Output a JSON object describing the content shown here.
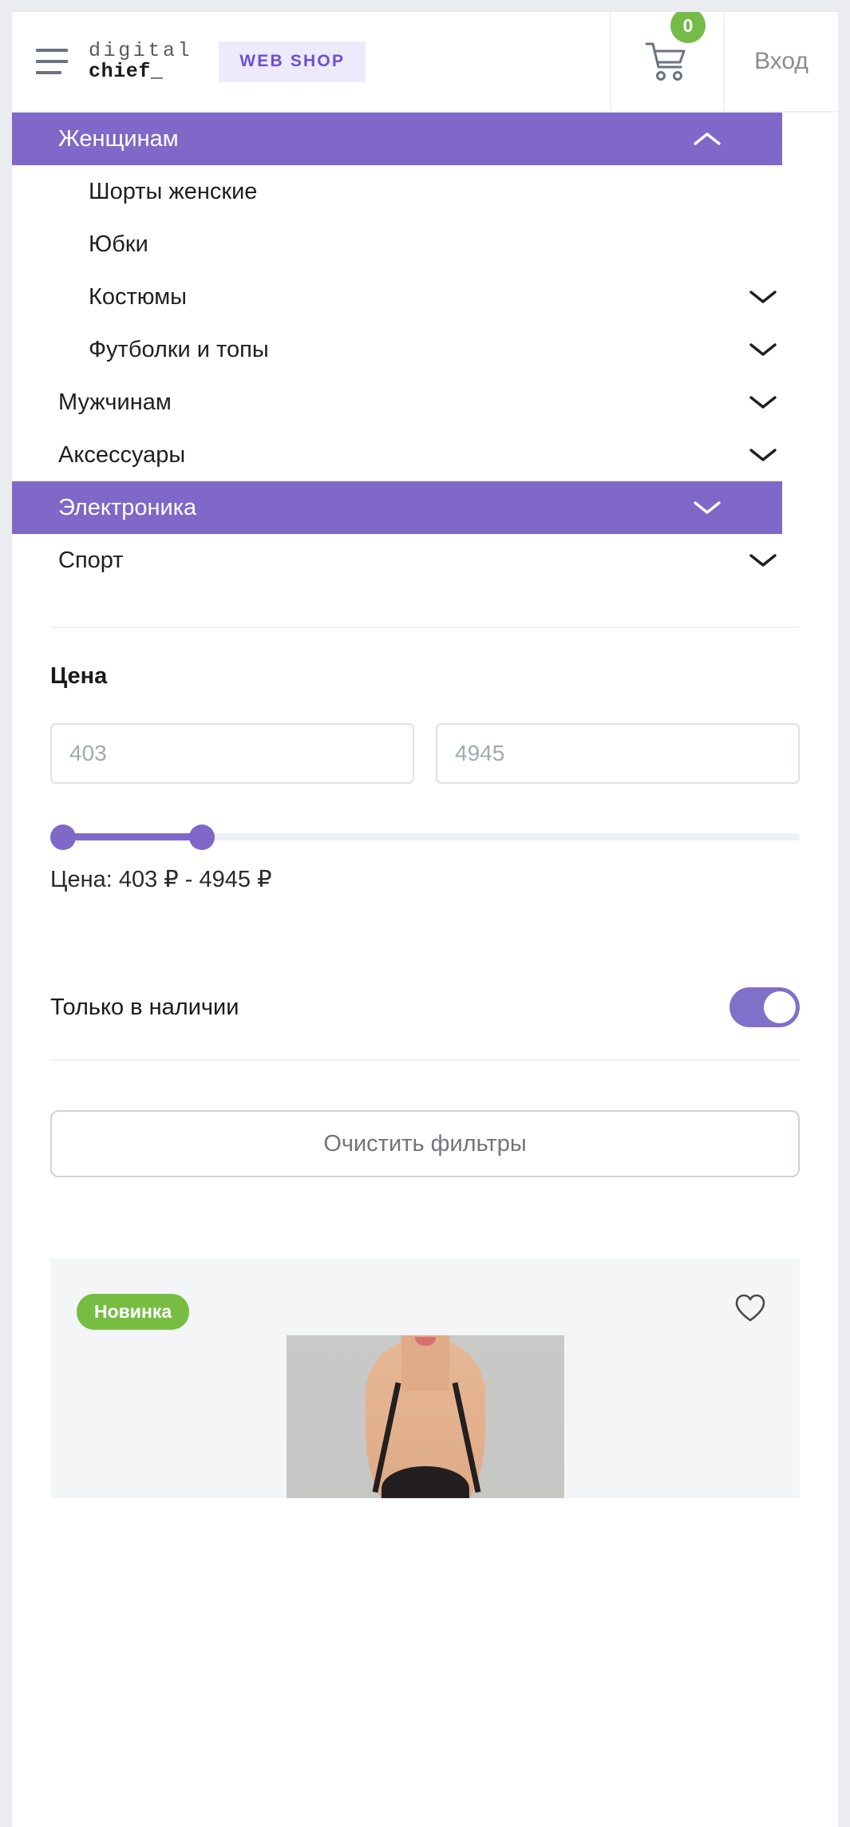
{
  "header": {
    "menu_icon": "hamburger-menu-icon",
    "logo_line1": "digital",
    "logo_line2": "chief_",
    "webshop_label": "WEB SHOP",
    "cart_icon": "shopping-cart-icon",
    "cart_count": "0",
    "login_label": "Вход"
  },
  "categories": [
    {
      "label": "Женщинам",
      "level": 0,
      "active": true,
      "chevron": "up",
      "name": "category-women"
    },
    {
      "label": "Шорты женские",
      "level": 1,
      "active": false,
      "chevron": null,
      "name": "category-womens-shorts"
    },
    {
      "label": "Юбки",
      "level": 1,
      "active": false,
      "chevron": null,
      "name": "category-skirts"
    },
    {
      "label": "Костюмы",
      "level": 1,
      "active": false,
      "chevron": "down",
      "name": "category-suits"
    },
    {
      "label": "Футболки и топы",
      "level": 1,
      "active": false,
      "chevron": "down",
      "name": "category-tshirts-tops"
    },
    {
      "label": "Мужчинам",
      "level": 0,
      "active": false,
      "chevron": "down",
      "name": "category-men"
    },
    {
      "label": "Аксессуары",
      "level": 0,
      "active": false,
      "chevron": "down",
      "name": "category-accessories"
    },
    {
      "label": "Электроника",
      "level": 0,
      "active": true,
      "chevron": "down",
      "name": "category-electronics"
    },
    {
      "label": "Спорт",
      "level": 0,
      "active": false,
      "chevron": "down",
      "name": "category-sport"
    }
  ],
  "filters": {
    "price_title": "Цена",
    "price_min_placeholder": "403",
    "price_max_placeholder": "4945",
    "price_min_value": "",
    "price_max_value": "",
    "price_readout": "Цена: 403 ₽ - 4945 ₽",
    "slider_min": 403,
    "slider_max": 4945,
    "in_stock_label": "Только в наличии",
    "in_stock_enabled": true,
    "clear_label": "Очистить фильтры"
  },
  "product": {
    "badge": "Новинка",
    "favorite_icon": "heart-icon",
    "favorite_active": false
  },
  "colors": {
    "accent_purple": "#7f68c8",
    "badge_green": "#76bd42",
    "cart_badge_green": "#74bb47",
    "webshop_bg": "#eceafb",
    "webshop_text": "#6d4fd0",
    "page_bg": "#eaecef",
    "card_bg": "#f4f5f7"
  }
}
